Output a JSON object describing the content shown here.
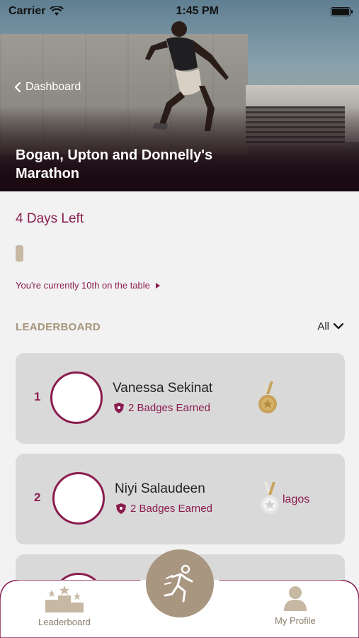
{
  "status_bar": {
    "carrier": "Carrier",
    "time": "1:45 PM"
  },
  "header": {
    "back_label": "Dashboard",
    "title": "Bogan, Upton and Donnelly's Marathon"
  },
  "challenge": {
    "days_left": "4 Days Left",
    "progress_fraction": 0.02,
    "rank_text": "You're currently 10th on the table"
  },
  "leaderboard": {
    "heading": "LEADERBOARD",
    "filter_label": "All",
    "entries": [
      {
        "rank": "1",
        "name": "Vanessa Sekinat",
        "badges": "2 Badges Earned",
        "medal": "gold",
        "city": ""
      },
      {
        "rank": "2",
        "name": "Niyi Salaudeen",
        "badges": "2 Badges Earned",
        "medal": "silver",
        "city": "lagos"
      },
      {
        "rank": "",
        "name": "",
        "badges": "",
        "medal": "",
        "city": ""
      }
    ]
  },
  "nav": {
    "leaderboard_label": "Leaderboard",
    "profile_label": "My Profile"
  },
  "colors": {
    "accent": "#8a1d4f",
    "tan": "#a99681",
    "card": "#d9d9d9",
    "background": "#f2f2f2"
  },
  "icons": [
    "wifi-icon",
    "battery-icon",
    "chevron-left-icon",
    "chevron-right-icon",
    "chevron-down-icon",
    "shield-badge-icon",
    "medal-icon",
    "podium-icon",
    "runner-icon",
    "profile-icon"
  ]
}
